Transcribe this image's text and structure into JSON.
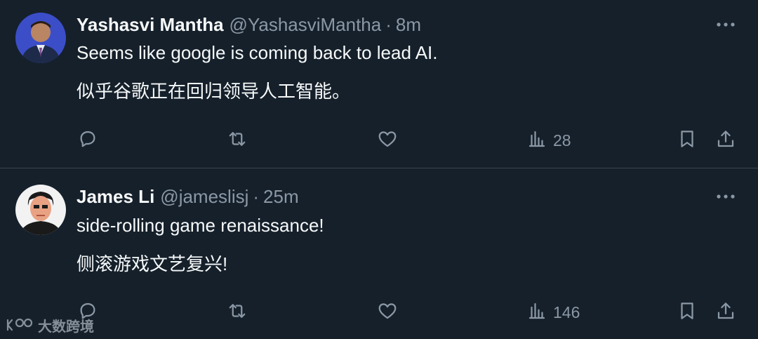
{
  "tweets": [
    {
      "name": "Yashasvi Mantha",
      "handle": "@YashasviMantha",
      "separator": "·",
      "time": "8m",
      "text_line1": "Seems like google is coming back to lead AI.",
      "text_line2": "似乎谷歌正在回归领导人工智能。",
      "views": "28"
    },
    {
      "name": "James Li",
      "handle": "@jameslisj",
      "separator": "·",
      "time": "25m",
      "text_line1": "side-rolling game renaissance!",
      "text_line2": "侧滚游戏文艺复兴!",
      "views": "146"
    }
  ],
  "icons": [
    "more-icon",
    "reply-icon",
    "retweet-icon",
    "like-icon",
    "views-icon",
    "bookmark-icon",
    "share-icon"
  ],
  "watermark": {
    "text": "大数跨境"
  },
  "colors": {
    "background": "#15202b",
    "text": "#f7f9f9",
    "secondary": "#8b98a5",
    "divider": "#38444d"
  }
}
